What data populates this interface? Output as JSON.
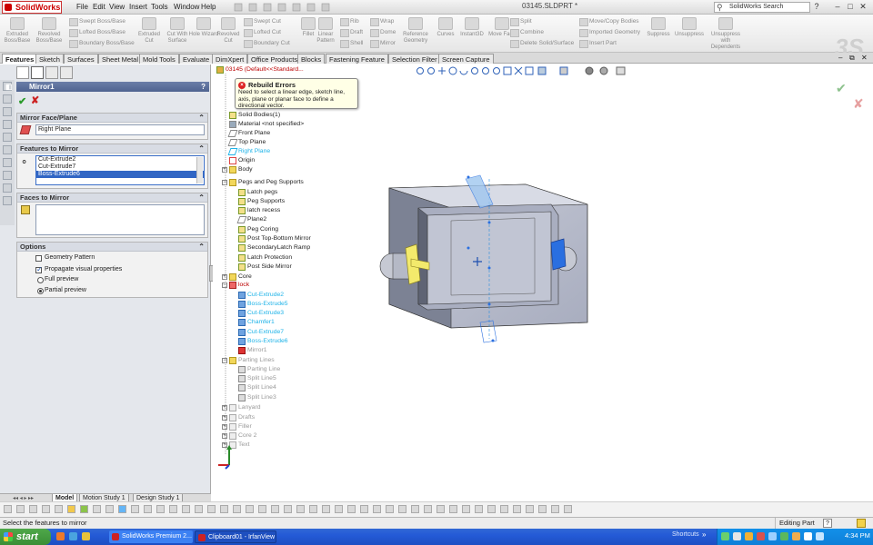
{
  "app": {
    "logo": "SolidWorks",
    "document_title": "03145.SLDPRT *",
    "search_placeholder": "SolidWorks Search"
  },
  "menu": [
    "File",
    "Edit",
    "View",
    "Insert",
    "Tools",
    "Window",
    "Help"
  ],
  "ribbon": {
    "big": [
      {
        "label": "Extruded Boss/Base"
      },
      {
        "label": "Revolved Boss/Base"
      },
      {
        "label": "Extruded Cut"
      },
      {
        "label": "Cut With Surface"
      },
      {
        "label": "Hole Wizard"
      },
      {
        "label": "Revolved Cut"
      },
      {
        "label": "Fillet"
      },
      {
        "label": "Linear Pattern"
      },
      {
        "label": "Reference Geometry"
      },
      {
        "label": "Curves"
      },
      {
        "label": "Instant3D"
      },
      {
        "label": "Move Face"
      },
      {
        "label": "Suppress"
      },
      {
        "label": "Unsuppress"
      },
      {
        "label": "Unsuppress with Dependents"
      }
    ],
    "small": [
      "Swept Boss/Base",
      "Lofted Boss/Base",
      "Boundary Boss/Base",
      "Swept Cut",
      "Lofted Cut",
      "Boundary Cut",
      "Rib",
      "Draft",
      "Shell",
      "Wrap",
      "Dome",
      "Mirror",
      "Split",
      "Combine",
      "Delete Solid/Surface",
      "Move/Copy Bodies",
      "Imported Geometry",
      "Insert Part"
    ]
  },
  "tabs": [
    "Features",
    "Sketch",
    "Surfaces",
    "Sheet Metal",
    "Mold Tools",
    "Evaluate",
    "DimXpert",
    "Office Products",
    "Blocks",
    "Fastening Feature",
    "Selection Filter",
    "Screen Capture"
  ],
  "property_manager": {
    "title": "Mirror1",
    "help": "?",
    "mirror_face": {
      "header": "Mirror Face/Plane",
      "value": "Right Plane"
    },
    "features": {
      "header": "Features to Mirror",
      "items": [
        "Cut-Extrude2",
        "Cut-Extrude7",
        "Boss-Extrude6"
      ]
    },
    "faces": {
      "header": "Faces to Mirror"
    },
    "options": {
      "header": "Options",
      "geometry_pattern": "Geometry Pattern",
      "propagate": "Propagate visual properties",
      "full_preview": "Full preview",
      "partial_preview": "Partial preview"
    }
  },
  "tooltip": {
    "title": "Rebuild Errors",
    "text": "Need to select a linear edge, sketch line, axis, plane or planar face to define a directional vector."
  },
  "tree": {
    "root": "03145 (Default<<Standard...",
    "nodes": [
      "Solid Bodies(1)",
      "Material <not specified>",
      "Front Plane",
      "Top Plane",
      "Right Plane",
      "Origin",
      "Body",
      "Pegs and Peg Supports",
      "Latch pegs",
      "Peg Supports",
      "latch recess",
      "Plane2",
      "Peg Coring",
      "Post Top-Bottom Mirror",
      "SecondaryLatch Ramp",
      "Latch Protection",
      "Post Side Mirror",
      "Core",
      "lock",
      "Cut-Extrude2",
      "Boss-Extrude5",
      "Cut-Extrude3",
      "Chamfer1",
      "Cut-Extrude7",
      "Boss-Extrude6",
      "Mirror1",
      "Parting Lines",
      "Parting Line",
      "Split Line5",
      "Split Line4",
      "Split Line3",
      "Lanyard",
      "Drafts",
      "Filler",
      "Core 2",
      "Text"
    ]
  },
  "bottom_tabs": [
    "Model",
    "Motion Study 1",
    "Design Study 1"
  ],
  "status": {
    "left": "Select the features to mirror",
    "right": "Editing Part",
    "help": "?"
  },
  "taskbar": {
    "start": "start",
    "tasks": [
      "SolidWorks Premium 2...",
      "Clipboard01 - IrfanView"
    ],
    "shortcuts": "Shortcuts",
    "clock": "4:34 PM"
  }
}
